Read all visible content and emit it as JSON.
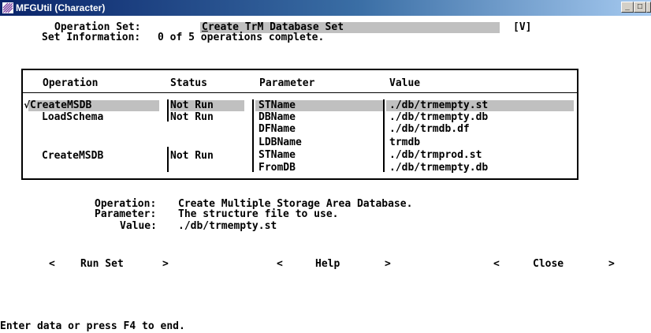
{
  "window": {
    "title": "MFGUtil (Character)",
    "controls": [
      "_",
      "□",
      "×"
    ]
  },
  "header": {
    "operation_set_label": "Operation Set:",
    "operation_set_first": "C",
    "operation_set_rest": "reate TrM Database Set",
    "operation_set_flag": "[V]",
    "set_info_label": "Set Information:",
    "set_info_value": "0 of 5 operations complete."
  },
  "table": {
    "columns": [
      "Operation",
      "Status",
      "Parameter",
      "Value"
    ],
    "selected_mark": "√",
    "operations": [
      {
        "name": "CreateMSDB",
        "status": "Not Run"
      },
      {
        "name": "LoadSchema",
        "status": "Not Run"
      },
      {
        "name": "CreateMSDB",
        "status": "Not Run"
      }
    ],
    "parameters": [
      {
        "parameter": "STName",
        "value": "./db/trmempty.st"
      },
      {
        "parameter": "DBName",
        "value": "./db/trmempty.db"
      },
      {
        "parameter": "DFName",
        "value": "./db/trmdb.df"
      },
      {
        "parameter": "LDBName",
        "value": "trmdb"
      },
      {
        "parameter": "STName",
        "value": "./db/trmprod.st"
      },
      {
        "parameter": "FromDB",
        "value": "./db/trmempty.db"
      }
    ]
  },
  "details": {
    "operation_label": "Operation:",
    "operation_value": "Create Multiple Storage Area Database.",
    "parameter_label": "Parameter:",
    "parameter_value": "The structure file to use.",
    "value_label": "Value:",
    "value_value": "./db/trmempty.st"
  },
  "buttons": {
    "left_bracket": "<",
    "right_bracket": ">",
    "run_set": "Run Set",
    "help": "Help",
    "close": "Close"
  },
  "status_line": "Enter data or press F4 to end."
}
